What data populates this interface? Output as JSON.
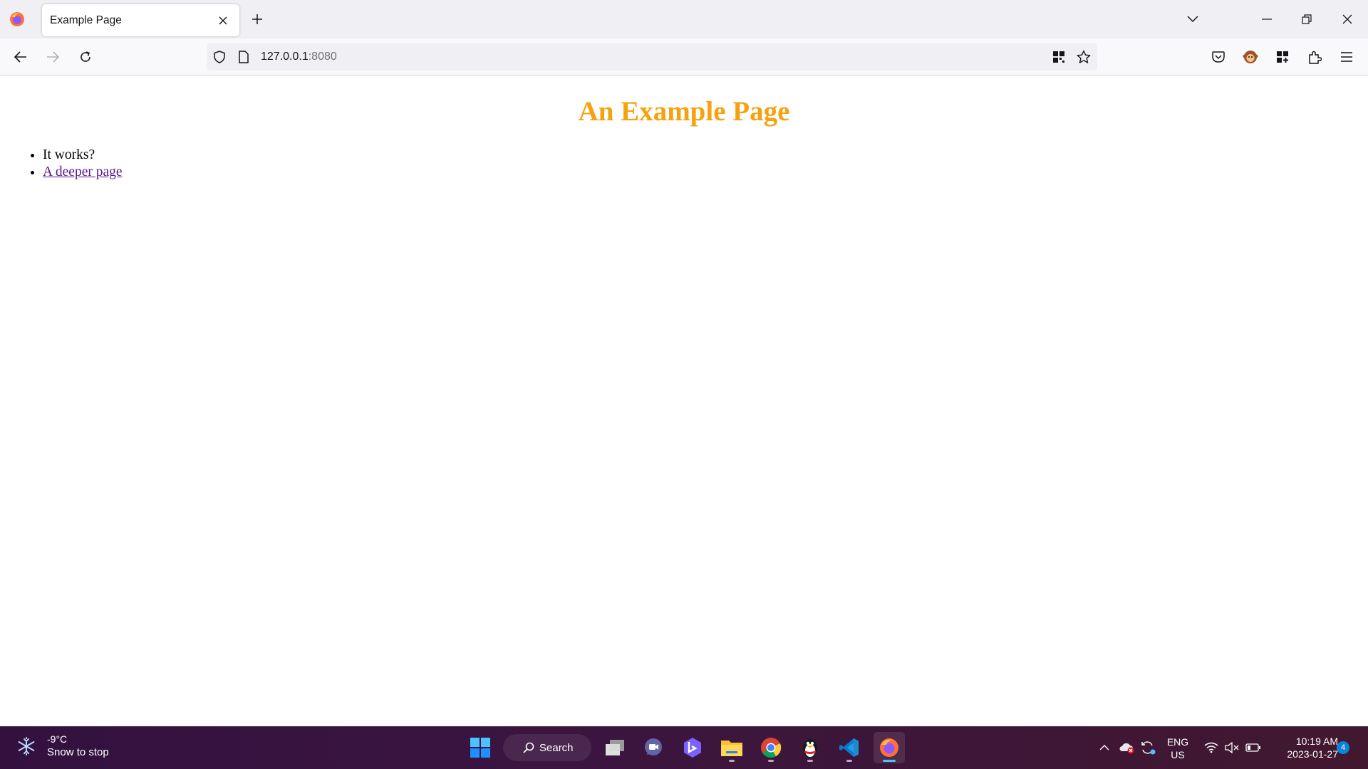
{
  "browser": {
    "tab": {
      "title": "Example Page"
    },
    "url": {
      "host": "127.0.0.1",
      "port": ":8080"
    }
  },
  "page": {
    "heading": "An Example Page",
    "items": [
      "It works?",
      "A deeper page"
    ]
  },
  "taskbar": {
    "weather": {
      "temp": "-9°C",
      "desc": "Snow to stop"
    },
    "search_label": "Search",
    "lang": {
      "line1": "ENG",
      "line2": "US"
    },
    "clock": {
      "time": "10:19 AM",
      "date": "2023-01-27"
    },
    "notification_count": "4"
  },
  "colors": {
    "heading": "#f5a20f",
    "visited_link": "#551a8b",
    "taskbar_accent": "#4cc2ff"
  }
}
